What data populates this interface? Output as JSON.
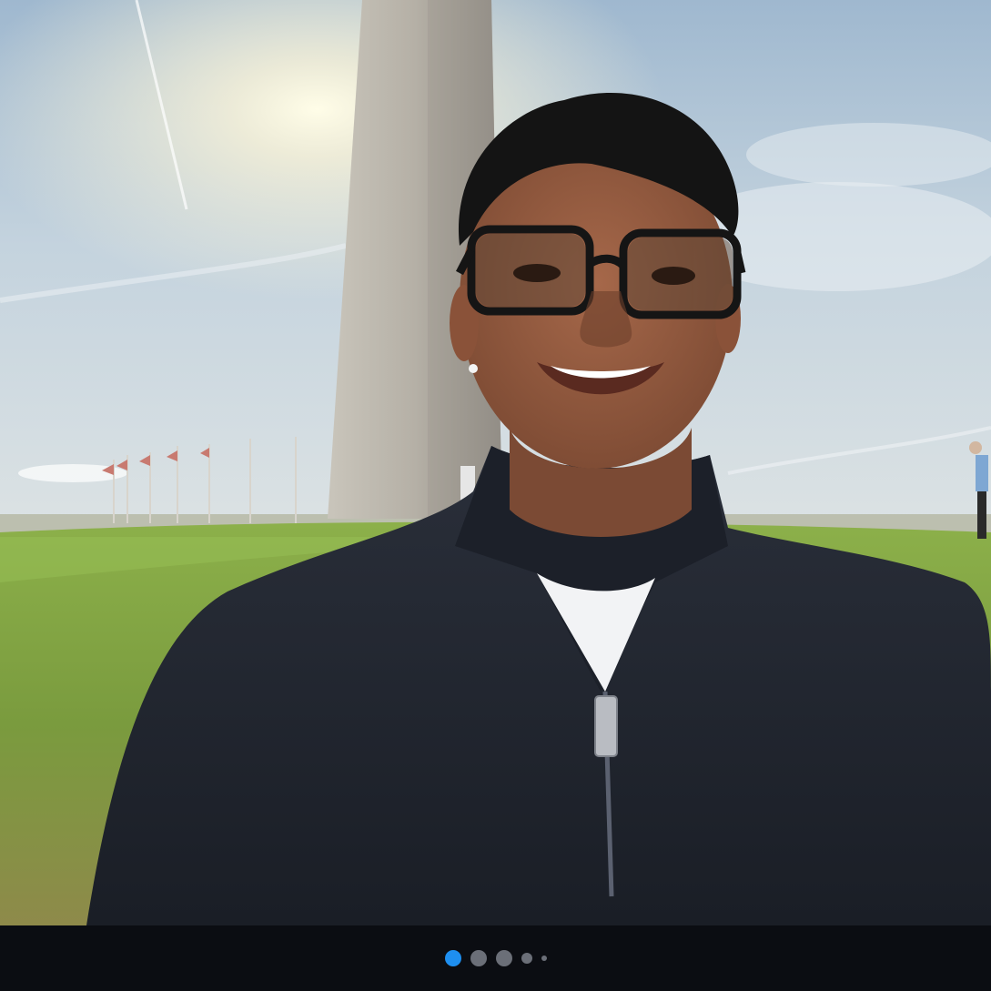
{
  "carousel": {
    "total_slides": 5,
    "active_index": 0,
    "active_color": "#1e8ff0",
    "inactive_color": "#6b6f78"
  },
  "photo": {
    "scene": "selfie-monument"
  }
}
